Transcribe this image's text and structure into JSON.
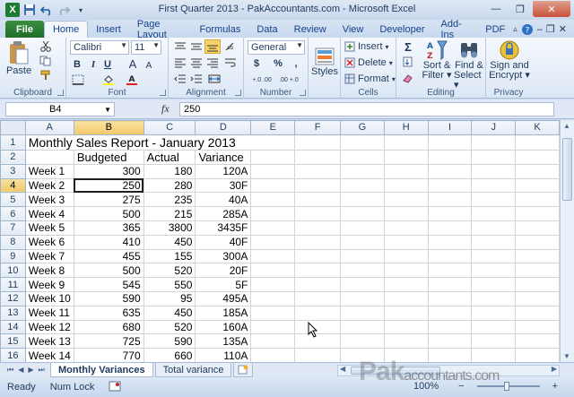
{
  "window": {
    "title": "First Quarter 2013 - PakAccountants.com - Microsoft Excel"
  },
  "tabs": [
    "File",
    "Home",
    "Insert",
    "Page Layout",
    "Formulas",
    "Data",
    "Review",
    "View",
    "Developer",
    "Add-Ins",
    "PDF"
  ],
  "active_tab": "Home",
  "ribbon": {
    "clipboard": {
      "label": "Clipboard",
      "paste": "Paste"
    },
    "font": {
      "label": "Font",
      "name": "Calibri",
      "size": "11",
      "bold": "B",
      "italic": "I",
      "underline": "U",
      "grow": "A",
      "shrink": "A"
    },
    "alignment": {
      "label": "Alignment"
    },
    "number": {
      "label": "Number",
      "format": "General",
      "currency": "$",
      "percent": "%",
      "comma": ",",
      "inc_decimal": "+.0 .00",
      "dec_decimal": ".00 +.0"
    },
    "styles": {
      "label": "Styles"
    },
    "cells": {
      "label": "Cells",
      "insert": "Insert",
      "delete": "Delete",
      "format": "Format"
    },
    "editing": {
      "label": "Editing",
      "sum": "Σ",
      "sort": "Sort &",
      "sort2": "Filter",
      "find": "Find &",
      "find2": "Select"
    },
    "privacy": {
      "label": "Privacy",
      "sign": "Sign and",
      "sign2": "Encrypt"
    }
  },
  "formula_bar": {
    "name_box": "B4",
    "fx": "fx",
    "value": "250"
  },
  "columns": [
    "A",
    "B",
    "C",
    "D",
    "E",
    "F",
    "G",
    "H",
    "I",
    "J",
    "K"
  ],
  "selected_cell": {
    "row": 4,
    "col": "B"
  },
  "sheet": {
    "title": "Monthly Sales Report - January 2013",
    "headers": [
      "Budgeted",
      "Actual",
      "Variance"
    ],
    "rows": [
      {
        "label": "Week 1",
        "budgeted": "300",
        "actual": "180",
        "variance": "120A"
      },
      {
        "label": "Week 2",
        "budgeted": "250",
        "actual": "280",
        "variance": "30F"
      },
      {
        "label": "Week 3",
        "budgeted": "275",
        "actual": "235",
        "variance": "40A"
      },
      {
        "label": "Week 4",
        "budgeted": "500",
        "actual": "215",
        "variance": "285A"
      },
      {
        "label": "Week 5",
        "budgeted": "365",
        "actual": "3800",
        "variance": "3435F"
      },
      {
        "label": "Week 6",
        "budgeted": "410",
        "actual": "450",
        "variance": "40F"
      },
      {
        "label": "Week 7",
        "budgeted": "455",
        "actual": "155",
        "variance": "300A"
      },
      {
        "label": "Week 8",
        "budgeted": "500",
        "actual": "520",
        "variance": "20F"
      },
      {
        "label": "Week 9",
        "budgeted": "545",
        "actual": "550",
        "variance": "5F"
      },
      {
        "label": "Week 10",
        "budgeted": "590",
        "actual": "95",
        "variance": "495A"
      },
      {
        "label": "Week 11",
        "budgeted": "635",
        "actual": "450",
        "variance": "185A"
      },
      {
        "label": "Week 12",
        "budgeted": "680",
        "actual": "520",
        "variance": "160A"
      },
      {
        "label": "Week 13",
        "budgeted": "725",
        "actual": "590",
        "variance": "135A"
      },
      {
        "label": "Week 14",
        "budgeted": "770",
        "actual": "660",
        "variance": "110A"
      }
    ]
  },
  "sheet_tabs": [
    "Monthly Variances",
    "Total variance"
  ],
  "active_sheet": "Monthly Variances",
  "status": {
    "ready": "Ready",
    "numlock": "Num Lock",
    "zoom": "100%"
  },
  "watermark": {
    "brand": "Pak",
    "suffix": "accountants.com"
  }
}
